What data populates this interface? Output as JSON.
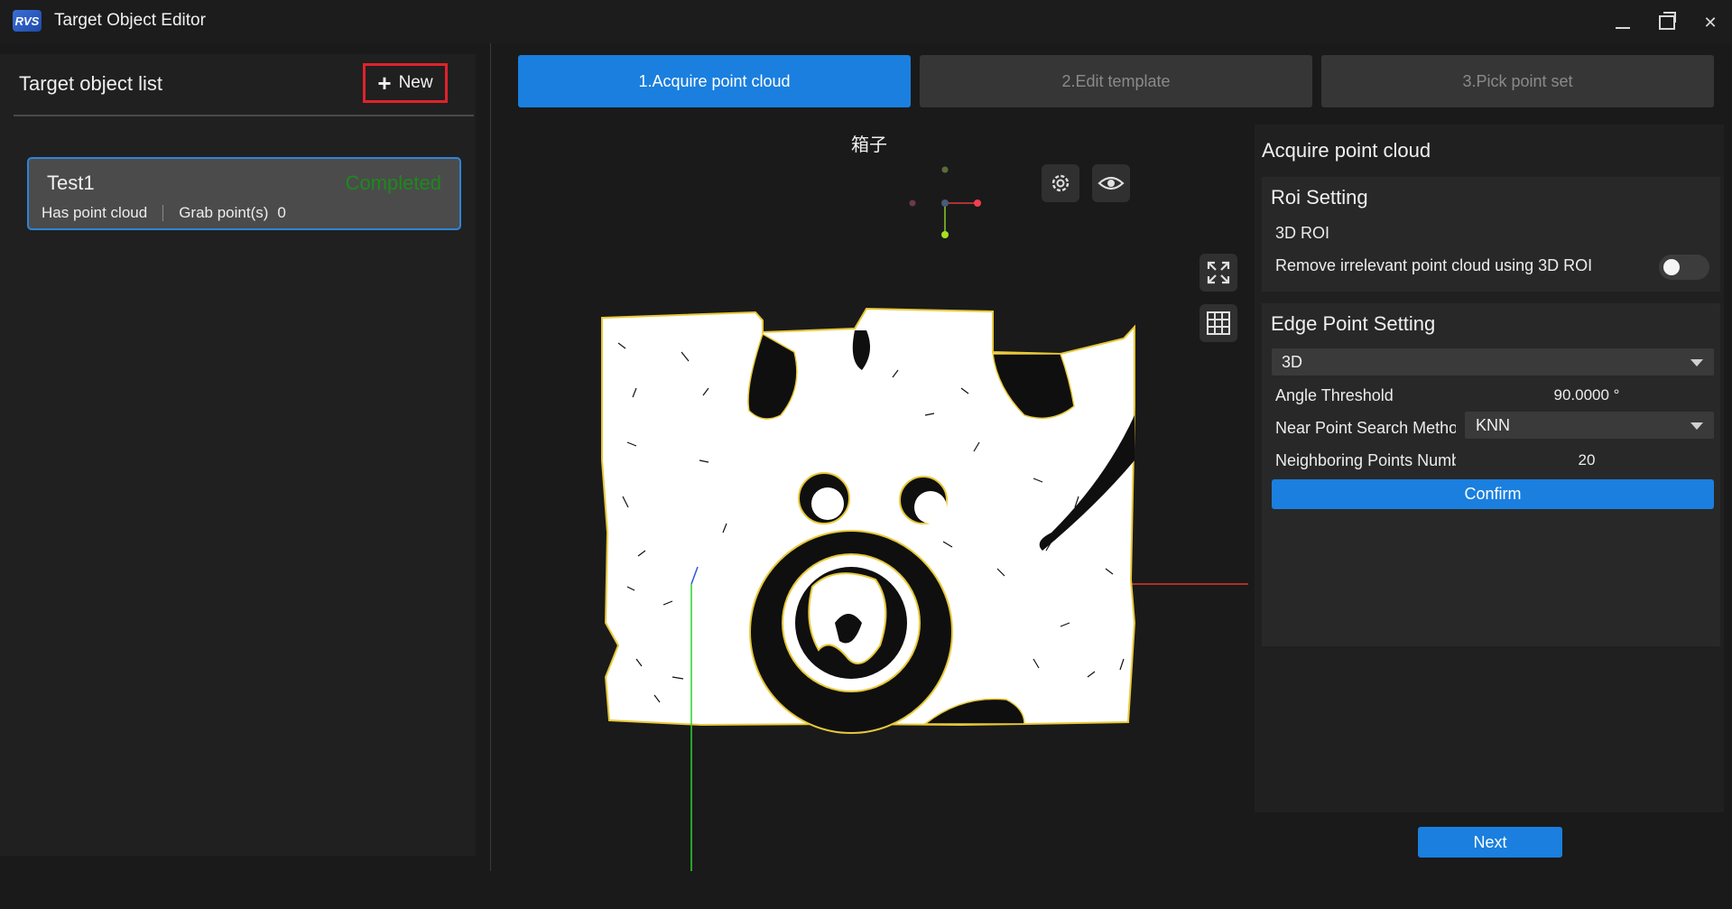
{
  "app": {
    "logo_text": "RVS",
    "title": "Target Object Editor"
  },
  "left": {
    "title": "Target object list",
    "new_label": "New",
    "items": [
      {
        "name": "Test1",
        "status": "Completed",
        "cloud": "Has point cloud",
        "grab_label": "Grab point(s)",
        "grab_value": "0"
      }
    ]
  },
  "tabs": [
    "1.Acquire point cloud",
    "2.Edit template",
    "3.Pick point set"
  ],
  "viewer": {
    "label": "箱子"
  },
  "panel": {
    "title": "Acquire point cloud",
    "roi": {
      "title": "Roi Setting",
      "label": "3D ROI",
      "toggle_text": "Remove irrelevant point cloud using 3D ROI",
      "toggle_on": false
    },
    "edge": {
      "title": "Edge Point Setting",
      "mode": "3D",
      "angle_label": "Angle Threshold",
      "angle_value": "90.0000 °",
      "near_label": "Near Point Search Method",
      "near_value": "KNN",
      "neigh_label": "Neighboring Points Number",
      "neigh_value": "20",
      "confirm": "Confirm"
    },
    "next": "Next"
  },
  "colors": {
    "accent": "#1a7fde",
    "status_completed": "#1c8a1c",
    "highlight": "#e0222b"
  }
}
